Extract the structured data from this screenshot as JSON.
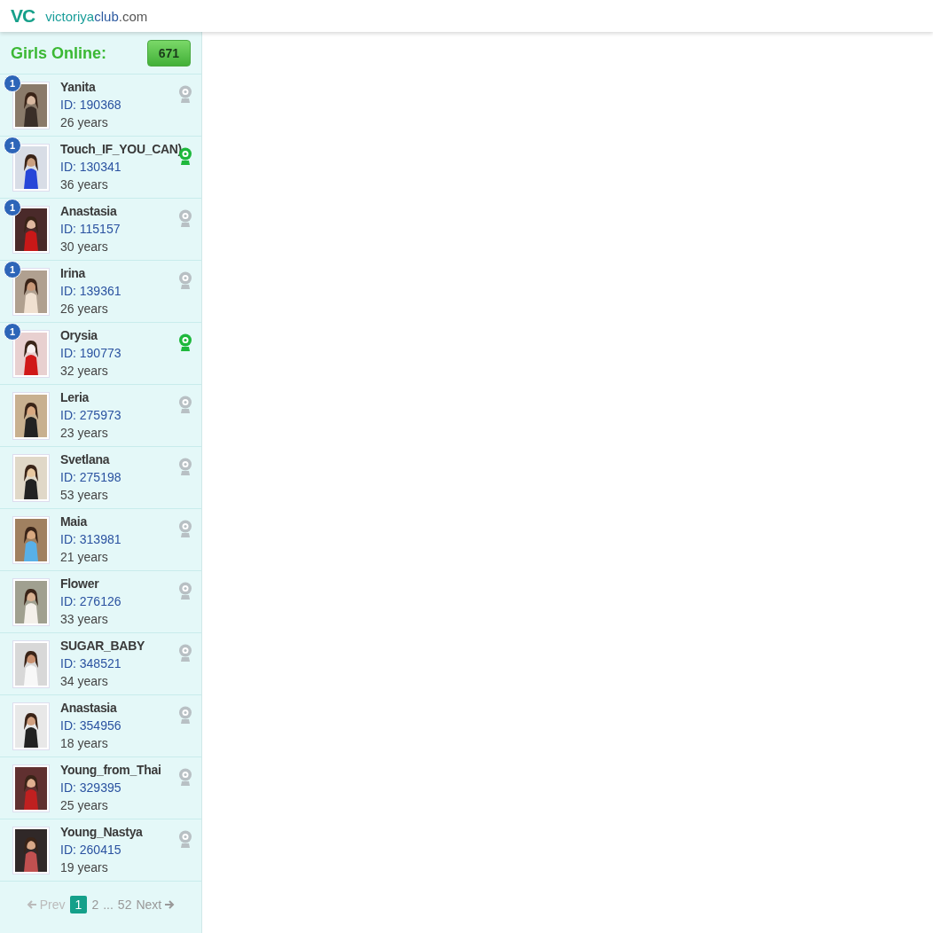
{
  "header": {
    "logo": "VC",
    "site_name": "victoriya",
    "site_name_bold": "club",
    "site_tld": ".com"
  },
  "sidebar": {
    "title": "Girls Online:",
    "count": "671",
    "profiles": [
      {
        "name": "Yanita",
        "id": "ID: 190368",
        "age": "26 years",
        "badge": "1",
        "camera_on": false
      },
      {
        "name": "Touch_IF_YOU_CAN)",
        "id": "ID: 130341",
        "age": "36 years",
        "badge": "1",
        "camera_on": true
      },
      {
        "name": "Anastasia",
        "id": "ID: 115157",
        "age": "30 years",
        "badge": "1",
        "camera_on": false
      },
      {
        "name": "Irina",
        "id": "ID: 139361",
        "age": "26 years",
        "badge": "1",
        "camera_on": false
      },
      {
        "name": "Orysia",
        "id": "ID: 190773",
        "age": "32 years",
        "badge": "1",
        "camera_on": true
      },
      {
        "name": "Leria",
        "id": "ID: 275973",
        "age": "23 years",
        "camera_on": false
      },
      {
        "name": "Svetlana",
        "id": "ID: 275198",
        "age": "53 years",
        "camera_on": false
      },
      {
        "name": "Maia",
        "id": "ID: 313981",
        "age": "21 years",
        "camera_on": false
      },
      {
        "name": "Flower",
        "id": "ID: 276126",
        "age": "33 years",
        "camera_on": false
      },
      {
        "name": "SUGAR_BABY",
        "id": "ID: 348521",
        "age": "34 years",
        "camera_on": false
      },
      {
        "name": "Anastasia",
        "id": "ID: 354956",
        "age": "18 years",
        "camera_on": false
      },
      {
        "name": "Young_from_Thai",
        "id": "ID: 329395",
        "age": "25 years",
        "camera_on": false
      },
      {
        "name": "Young_Nastya",
        "id": "ID: 260415",
        "age": "19 years",
        "camera_on": false
      }
    ],
    "pagination": {
      "prev": {
        "label": "Prev",
        "disabled": true
      },
      "pages": [
        {
          "kind": "page",
          "label": "1",
          "selected": true
        },
        {
          "kind": "page",
          "label": "2",
          "selected": false
        },
        {
          "kind": "ellipsis",
          "label": "..."
        },
        {
          "kind": "page",
          "label": "52",
          "selected": false
        }
      ],
      "next": {
        "label": "Next",
        "disabled": false
      }
    }
  }
}
